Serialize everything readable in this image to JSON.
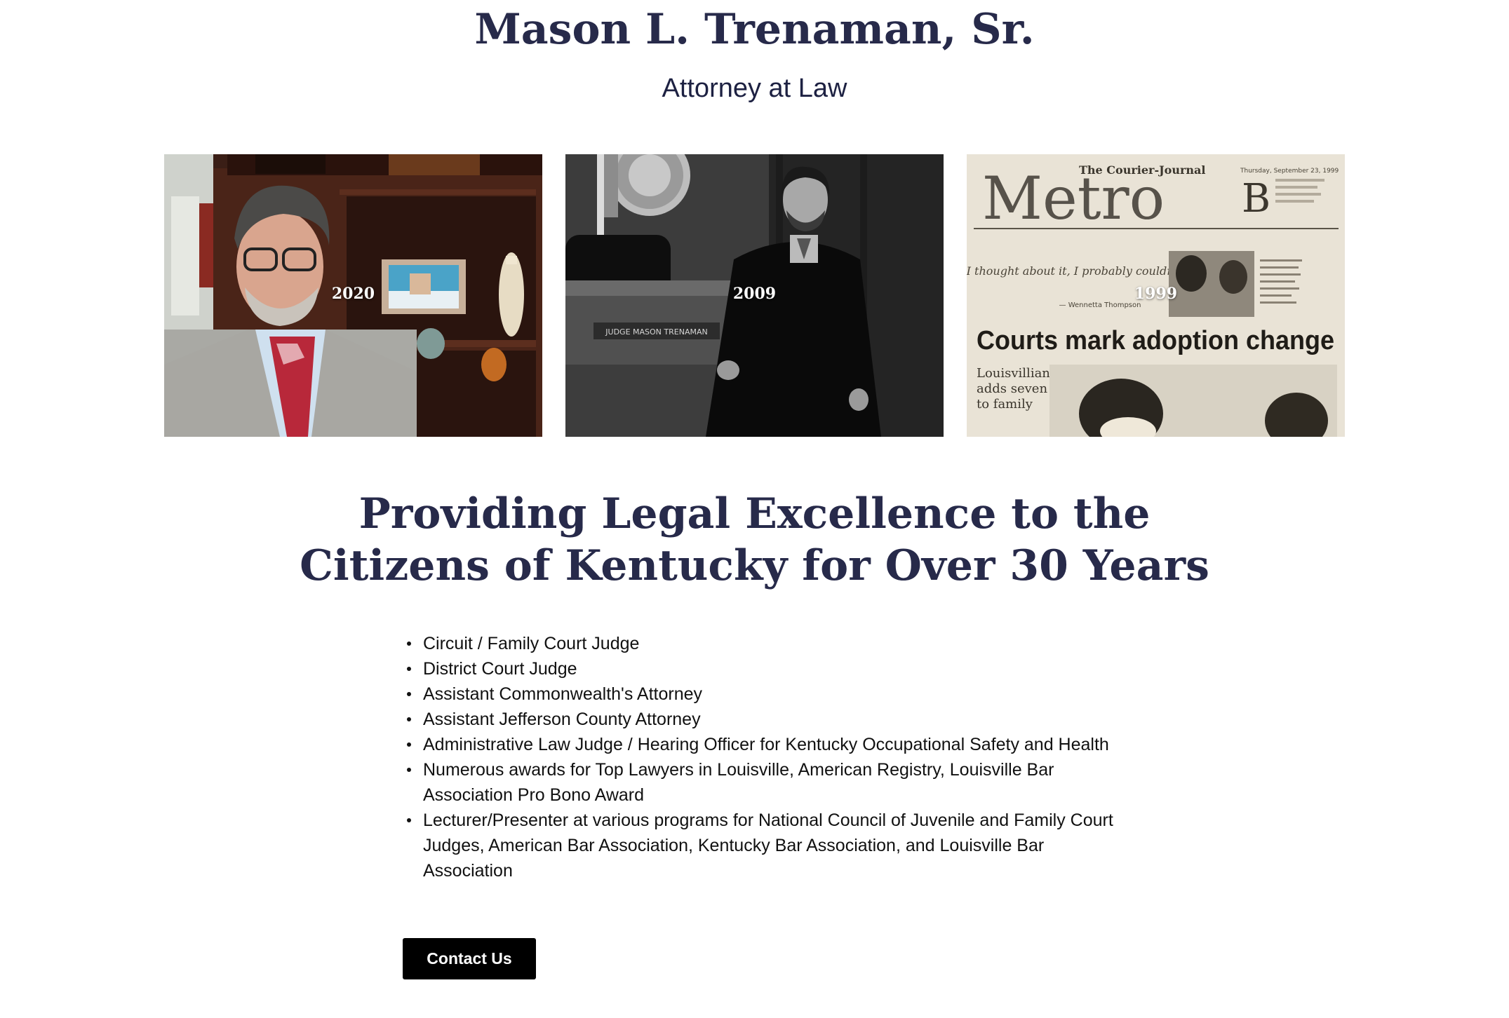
{
  "header": {
    "title": "Mason L. Trenaman, Sr.",
    "subtitle": "Attorney at Law"
  },
  "gallery": {
    "photos": [
      {
        "year": "2020"
      },
      {
        "year": "2009",
        "nameplate": "JUDGE MASON TRENAMAN"
      },
      {
        "year": "1999",
        "masthead": "Metro",
        "paper_name": "The Courier-Journal",
        "section_letter": "B",
        "date_line": "Thursday, September 23, 1999",
        "quote": "“If I thought about it, I probably couldn’t do it.”",
        "quote_attribution": "— Wennetta Thompson",
        "headline": "Courts mark adoption change",
        "subhead_lines": [
          "Louisvillian",
          "adds seven",
          "to family"
        ]
      }
    ]
  },
  "main": {
    "headline_lines": [
      "Providing Legal Excellence to the",
      "Citizens of Kentucky for Over 30 Years"
    ],
    "credentials": [
      "Circuit / Family Court Judge",
      "District Court Judge",
      "Assistant Commonwealth's Attorney",
      "Assistant Jefferson County Attorney",
      "Administrative Law Judge / Hearing Officer for Kentucky Occupational Safety and Health",
      "Numerous awards for Top Lawyers in Louisville, American Registry, Louisville Bar Association Pro Bono Award",
      "Lecturer/Presenter at various programs for National Council of Juvenile and Family Court Judges, American Bar Association, Kentucky Bar Association, and Louisville Bar Association"
    ],
    "contact_label": "Contact Us"
  }
}
